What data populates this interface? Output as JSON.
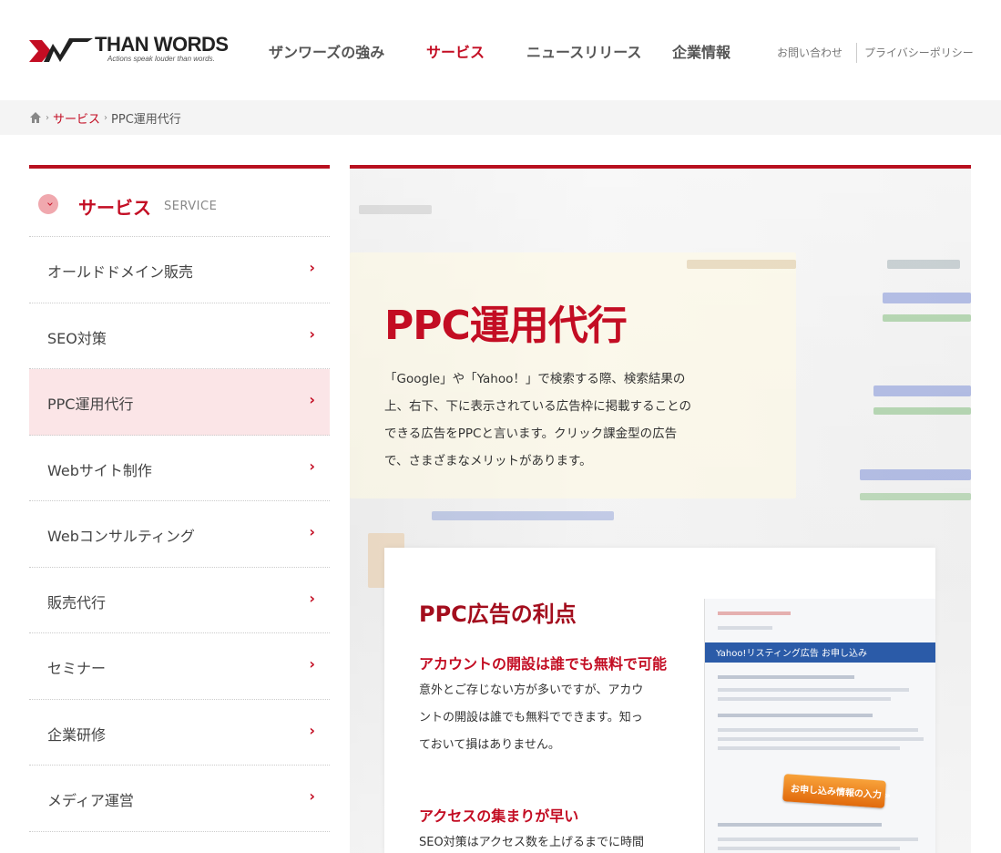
{
  "header": {
    "logo": {
      "name": "THAN WORDS",
      "tagline": "Actions speak louder than words."
    },
    "nav": [
      {
        "label": "ザンワーズの強み",
        "active": false
      },
      {
        "label": "サービス",
        "active": true
      },
      {
        "label": "ニュースリリース",
        "active": false
      },
      {
        "label": "企業情報",
        "active": false
      }
    ],
    "util": [
      {
        "label": "お問い合わせ"
      },
      {
        "label": "プライバシーポリシー"
      }
    ]
  },
  "breadcrumb": {
    "home_icon": "home-icon",
    "items": [
      {
        "label": "サービス",
        "link": true
      },
      {
        "label": "PPC運用代行",
        "link": false
      }
    ]
  },
  "sidebar": {
    "title": "サービス",
    "subtitle": "SERVICE",
    "items": [
      {
        "label": "オールドドメイン販売",
        "active": false
      },
      {
        "label": "SEO対策",
        "active": false
      },
      {
        "label": "PPC運用代行",
        "active": true
      },
      {
        "label": "Webサイト制作",
        "active": false
      },
      {
        "label": "Webコンサルティング",
        "active": false
      },
      {
        "label": "販売代行",
        "active": false
      },
      {
        "label": "セミナー",
        "active": false
      },
      {
        "label": "企業研修",
        "active": false
      },
      {
        "label": "メディア運営",
        "active": false
      }
    ],
    "chevron": "›"
  },
  "main": {
    "title": "PPC運用代行",
    "lead_lines": [
      "「Google」や「Yahoo！」で検索する際、検索結果の",
      "上、右下、下に表示されている広告枠に掲載することの",
      "できる広告をPPCと言います。クリック課金型の広告",
      "で、さまざまなメリットがあります。"
    ],
    "card": {
      "title": "PPC広告の利点",
      "sections": [
        {
          "heading": "アカウントの開設は誰でも無料で可能",
          "lines": [
            "意外とご存じない方が多いですが、アカウ",
            "ントの開設は誰でも無料でできます。知っ",
            "ておいて損はありません。"
          ]
        },
        {
          "heading": "アクセスの集まりが早い",
          "lines": [
            "SEO対策はアクセス数を上げるまでに時間"
          ]
        }
      ],
      "image": {
        "bar_text": "Yahoo!リスティング広告 お申し込み",
        "button_text": "お申し込み情報の入力 »"
      }
    }
  },
  "colors": {
    "brand_red": "#c30d23",
    "active_bg": "#fbe5e7"
  }
}
